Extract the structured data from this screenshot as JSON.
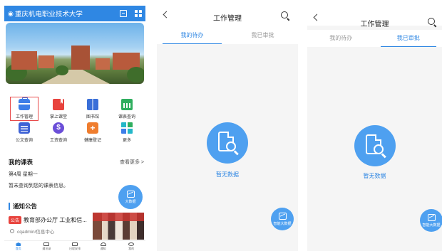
{
  "home": {
    "header": {
      "title": "重庆机电职业技术大学"
    },
    "apps": [
      {
        "label": "工作管理",
        "icon": "briefcase-icon"
      },
      {
        "label": "掌上课堂",
        "icon": "book-icon"
      },
      {
        "label": "图书馆",
        "icon": "library-icon"
      },
      {
        "label": "课表查询",
        "icon": "calendar-icon"
      },
      {
        "label": "公文查询",
        "icon": "document-icon"
      },
      {
        "label": "工资查询",
        "icon": "wage-icon"
      },
      {
        "label": "健康登记",
        "icon": "health-icon"
      },
      {
        "label": "更多",
        "icon": "more-grid-icon"
      }
    ],
    "schedule": {
      "title": "我的课表",
      "more": "查看更多 >",
      "week": "第4周  星期一",
      "empty": "暂未查询到您的课表信息。"
    },
    "notice": {
      "title": "通知公告",
      "tag": "公告",
      "headline": "教育部办公厅 工业和信...",
      "author": "cqadmin/信息中心"
    },
    "fab_label": "大数据",
    "tabbar": [
      "首页",
      "通讯录",
      "日程安排",
      "通知",
      "我的"
    ]
  },
  "work_todo": {
    "title": "工作管理",
    "tabs": [
      "我的待办",
      "我已审批"
    ],
    "active_tab": 0,
    "empty_text": "暂无数据",
    "fab_label": "智能大数据"
  },
  "work_done": {
    "title": "工作管理",
    "tabs": [
      "我的待办",
      "我已审批"
    ],
    "active_tab": 1,
    "empty_text": "暂无数据",
    "fab_label": "智能大数据"
  },
  "colors": {
    "primary": "#2f87e3",
    "accent_blue": "#4ea0f0",
    "highlight_red": "#e84b4b"
  }
}
